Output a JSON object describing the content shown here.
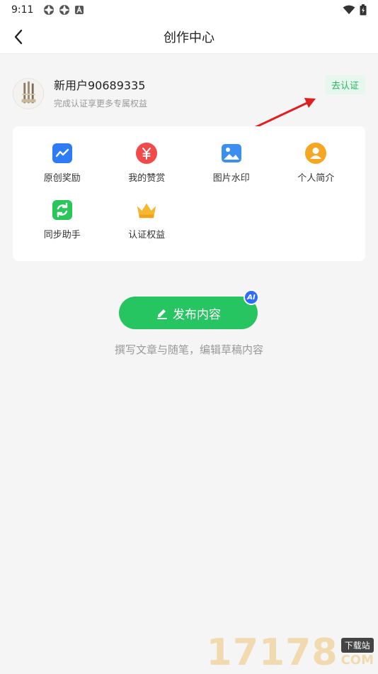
{
  "status_bar": {
    "time": "9:11"
  },
  "nav": {
    "title": "创作中心"
  },
  "profile": {
    "name": "新用户90689335",
    "subtitle": "完成认证享更多专属权益",
    "verify_label": "去认证"
  },
  "features": [
    {
      "label": "原创奖励",
      "icon": "trend-chart-icon",
      "color": "#2f7bf5"
    },
    {
      "label": "我的赞赏",
      "icon": "yuan-icon",
      "color": "#f04a4a"
    },
    {
      "label": "图片水印",
      "icon": "image-icon",
      "color": "#3b8ff3"
    },
    {
      "label": "个人简介",
      "icon": "user-icon",
      "color": "#f5a623"
    },
    {
      "label": "同步助手",
      "icon": "sync-icon",
      "color": "#2bc65a"
    },
    {
      "label": "认证权益",
      "icon": "crown-icon",
      "color": "#f5b72e"
    }
  ],
  "publish": {
    "label": "发布内容",
    "badge": "AI",
    "hint": "撰写文章与随笔，编辑草稿内容"
  },
  "watermark": {
    "number": "17178",
    "tag": "下载站",
    "domain": "COM"
  }
}
